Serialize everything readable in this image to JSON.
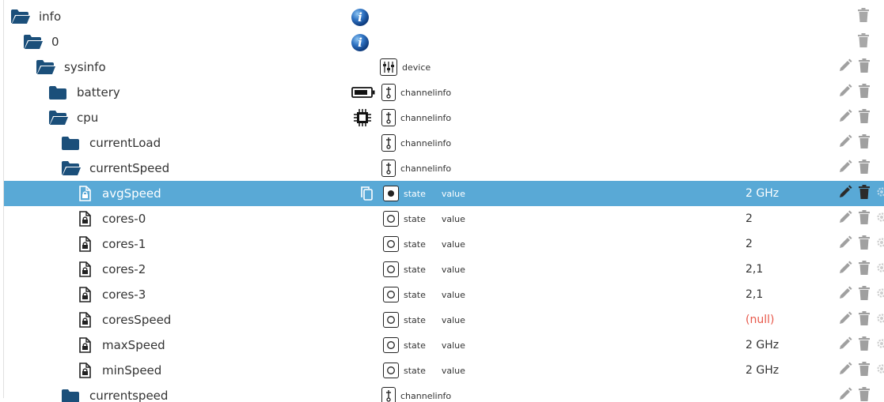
{
  "colors": {
    "folder": "#1b4f7a",
    "selected_bg": "#59a9d6",
    "null_value": "#e8584a",
    "action_gray": "#a0a0a0"
  },
  "rows": [
    {
      "name": "info",
      "kind": "folder-open",
      "indent": 0,
      "meta": "info"
    },
    {
      "name": "0",
      "kind": "folder-open",
      "indent": 1,
      "meta": "info"
    },
    {
      "name": "sysinfo",
      "kind": "folder-open",
      "indent": 2,
      "type": "device"
    },
    {
      "name": "battery",
      "kind": "folder",
      "indent": 3,
      "type": "channelinfo",
      "hw": "battery-icon"
    },
    {
      "name": "cpu",
      "kind": "folder-open",
      "indent": 3,
      "type": "channelinfo",
      "hw": "cpu-chip-icon"
    },
    {
      "name": "currentLoad",
      "kind": "folder",
      "indent": 4,
      "type": "channelinfo"
    },
    {
      "name": "currentSpeed",
      "kind": "folder-open",
      "indent": 4,
      "type": "channelinfo"
    },
    {
      "name": "avgSpeed",
      "kind": "state",
      "indent": 5,
      "type": "state",
      "role": "value",
      "value": "2 GHz",
      "selected": true
    },
    {
      "name": "cores-0",
      "kind": "state",
      "indent": 5,
      "type": "state",
      "role": "value",
      "value": "2"
    },
    {
      "name": "cores-1",
      "kind": "state",
      "indent": 5,
      "type": "state",
      "role": "value",
      "value": "2"
    },
    {
      "name": "cores-2",
      "kind": "state",
      "indent": 5,
      "type": "state",
      "role": "value",
      "value": "2,1"
    },
    {
      "name": "cores-3",
      "kind": "state",
      "indent": 5,
      "type": "state",
      "role": "value",
      "value": "2,1"
    },
    {
      "name": "coresSpeed",
      "kind": "state",
      "indent": 5,
      "type": "state",
      "role": "value",
      "value": "(null)",
      "null": true
    },
    {
      "name": "maxSpeed",
      "kind": "state",
      "indent": 5,
      "type": "state",
      "role": "value",
      "value": "2 GHz"
    },
    {
      "name": "minSpeed",
      "kind": "state",
      "indent": 5,
      "type": "state",
      "role": "value",
      "value": "2 GHz"
    },
    {
      "name": "currentspeed",
      "kind": "folder",
      "indent": 4,
      "type": "channelinfo",
      "cut": true
    }
  ]
}
